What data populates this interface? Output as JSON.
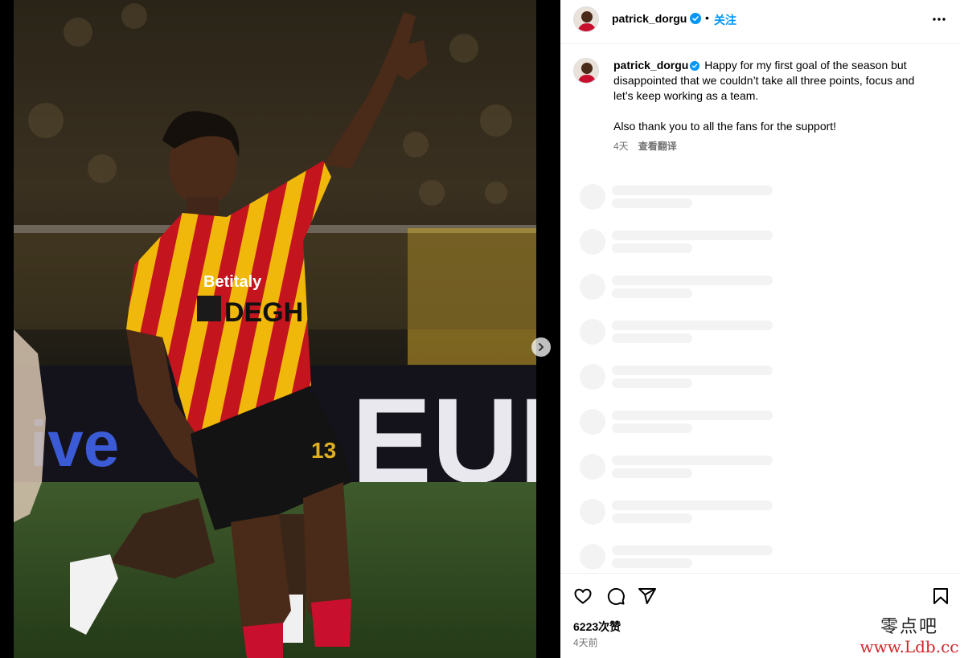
{
  "post": {
    "username": "patrick_dorgu",
    "follow_label": "关注",
    "dot": "•",
    "caption": {
      "text_line1": "Happy for my first goal of the season but disappointed that we couldn’t take all three points, focus and let’s keep working as a team.",
      "text_line2": "Also thank you to all the fans for the support!",
      "age": "4天",
      "translate_label": "查看翻译"
    },
    "likes": "6223次赞",
    "time_ago": "4天前"
  },
  "photo": {
    "sponsor_text": "Betitaly",
    "jersey_text": "DEGH",
    "board_text": "EUI",
    "board_text_left": "ive",
    "number": "13"
  },
  "watermark": {
    "cn": "零点吧",
    "en": "www.Ldb.cc"
  },
  "icons": {
    "next": "chevron-right-icon",
    "more": "more-horizontal-icon",
    "like": "heart-icon",
    "comment": "comment-icon",
    "share": "send-icon",
    "save": "bookmark-icon",
    "verified": "verified-badge-icon"
  },
  "colors": {
    "accent": "#0095f6",
    "verified": "#0095f6",
    "secondary_text": "#737373",
    "jersey_red": "#c8102e",
    "jersey_yellow": "#f2b705"
  }
}
